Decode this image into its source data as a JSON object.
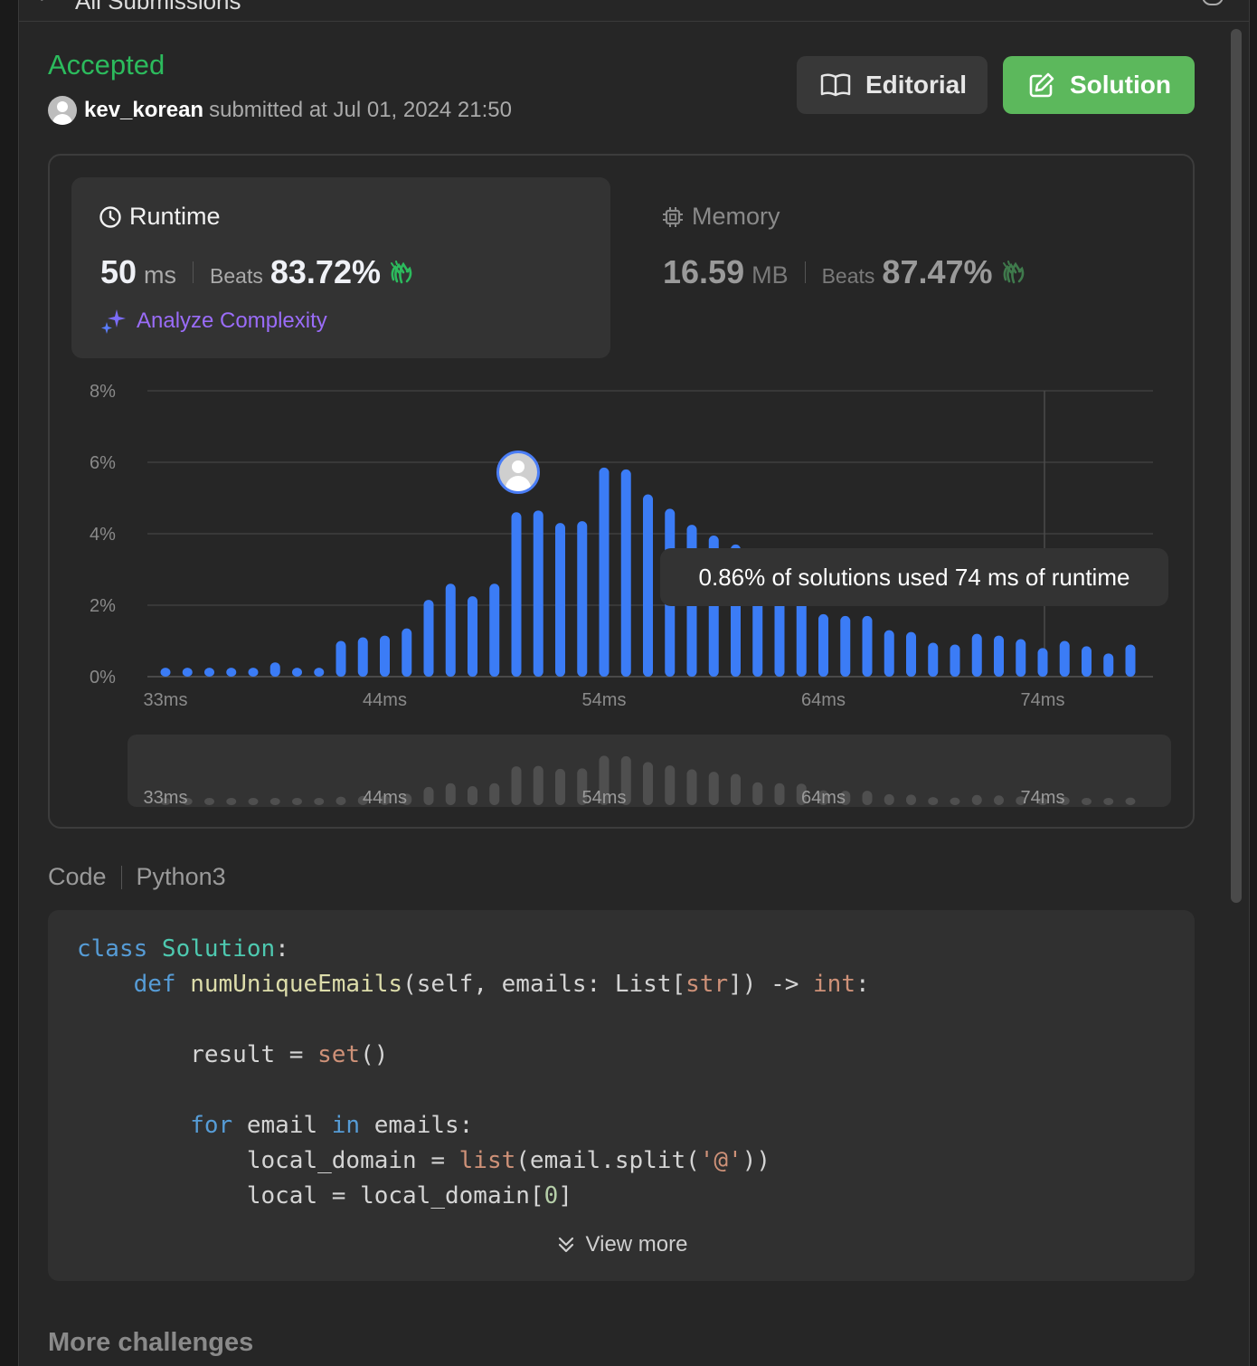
{
  "topbar": {
    "crumb": "All Submissions"
  },
  "submission": {
    "status": "Accepted",
    "user": "kev_korean",
    "submitted_text": "submitted at Jul 01, 2024 21:50"
  },
  "buttons": {
    "editorial": "Editorial",
    "solution": "Solution"
  },
  "runtime": {
    "title": "Runtime",
    "value": "50",
    "unit": "ms",
    "beats_label": "Beats",
    "beats_pct": "83.72%",
    "analyze": "Analyze Complexity"
  },
  "memory": {
    "title": "Memory",
    "value": "16.59",
    "unit": "MB",
    "beats_label": "Beats",
    "beats_pct": "87.47%"
  },
  "tooltip": "0.86% of solutions used 74 ms of runtime",
  "chart_data": {
    "type": "bar",
    "y_ticks": [
      "8%",
      "6%",
      "4%",
      "2%",
      "0%"
    ],
    "ylim": [
      0,
      8
    ],
    "x_ticks": [
      "33ms",
      "44ms",
      "54ms",
      "64ms",
      "74ms"
    ],
    "values": [
      0.25,
      0.25,
      0.25,
      0.25,
      0.25,
      0.4,
      0.25,
      0.25,
      1.0,
      1.1,
      1.15,
      1.35,
      2.15,
      2.6,
      2.25,
      2.6,
      4.6,
      4.65,
      4.3,
      4.35,
      5.85,
      5.8,
      5.1,
      4.7,
      4.25,
      3.95,
      3.7,
      2.7,
      2.6,
      2.55,
      1.75,
      1.7,
      1.7,
      1.3,
      1.25,
      0.95,
      0.9,
      1.2,
      1.15,
      1.05,
      0.8,
      1.0,
      0.85,
      0.65,
      0.9
    ],
    "series_color": "#3b7cf6",
    "user_marker_value": "50 ms"
  },
  "code": {
    "label": "Code",
    "language": "Python3",
    "lines": [
      [
        {
          "t": "class ",
          "c": "kw"
        },
        {
          "t": "Solution",
          "c": "cls"
        },
        {
          "t": ":",
          "c": ""
        }
      ],
      [
        {
          "t": "    ",
          "c": ""
        },
        {
          "t": "def ",
          "c": "kw"
        },
        {
          "t": "numUniqueEmails",
          "c": "fn"
        },
        {
          "t": "(self, emails: List[",
          "c": ""
        },
        {
          "t": "str",
          "c": "bi"
        },
        {
          "t": "]) -> ",
          "c": ""
        },
        {
          "t": "int",
          "c": "bi"
        },
        {
          "t": ":",
          "c": ""
        }
      ],
      [
        {
          "t": "",
          "c": ""
        }
      ],
      [
        {
          "t": "        result = ",
          "c": ""
        },
        {
          "t": "set",
          "c": "bi"
        },
        {
          "t": "()",
          "c": ""
        }
      ],
      [
        {
          "t": "",
          "c": ""
        }
      ],
      [
        {
          "t": "        ",
          "c": ""
        },
        {
          "t": "for",
          "c": "kw"
        },
        {
          "t": " email ",
          "c": ""
        },
        {
          "t": "in",
          "c": "kw"
        },
        {
          "t": " emails:",
          "c": ""
        }
      ],
      [
        {
          "t": "            local_domain = ",
          "c": ""
        },
        {
          "t": "list",
          "c": "bi"
        },
        {
          "t": "(email.split(",
          "c": ""
        },
        {
          "t": "'@'",
          "c": "str"
        },
        {
          "t": "))",
          "c": ""
        }
      ],
      [
        {
          "t": "            local = local_domain[",
          "c": ""
        },
        {
          "t": "0",
          "c": "num"
        },
        {
          "t": "]",
          "c": ""
        }
      ]
    ],
    "view_more": "View more"
  },
  "footer": {
    "more": "More challenges"
  },
  "colors": {
    "accepted": "#2cbb5d",
    "solution_btn": "#5cb85c",
    "bar": "#3b7cf6",
    "analyze": "#9a6cf8"
  }
}
